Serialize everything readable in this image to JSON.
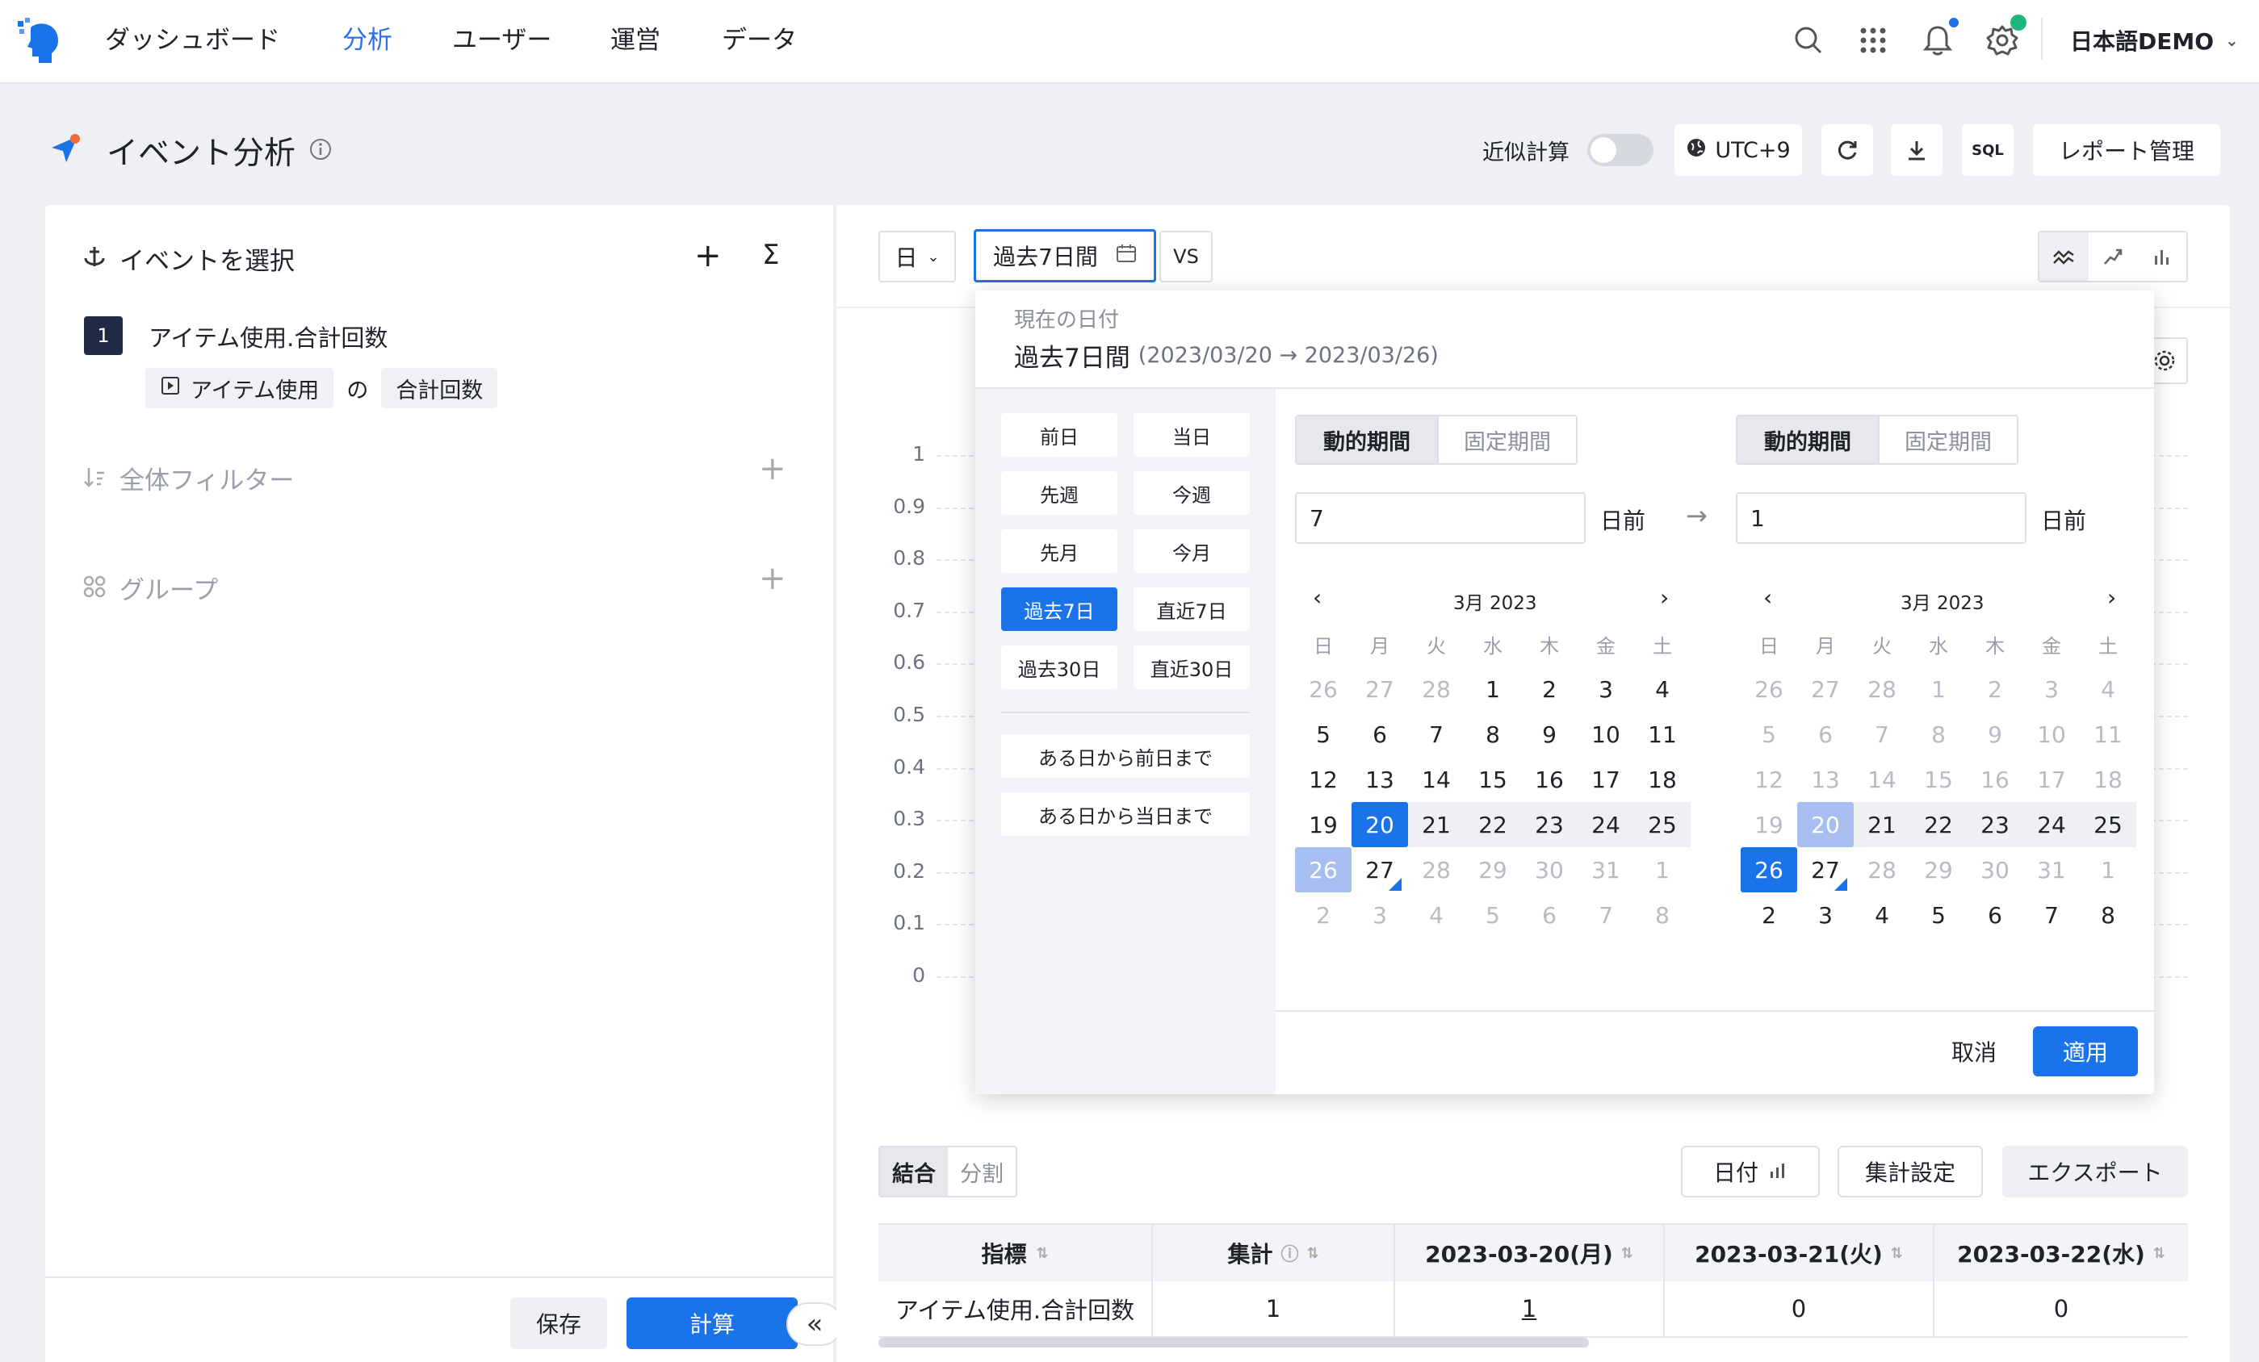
{
  "nav": {
    "items": [
      "ダッシュボード",
      "分析",
      "ユーザー",
      "運営",
      "データ"
    ],
    "active_index": 1,
    "user": "日本語DEMO"
  },
  "header": {
    "title": "イベント分析",
    "approx_label": "近似計算",
    "timezone": "UTC+9",
    "sql": "SQL",
    "report_button": "レポート管理"
  },
  "left": {
    "event_section": "イベントを選択",
    "event_index": "1",
    "event_name": "アイテム使用.合計回数",
    "event_chip": "アイテム使用",
    "of": "の",
    "metric_chip": "合計回数",
    "filter_section": "全体フィルター",
    "group_section": "グループ",
    "save": "保存",
    "calc": "計算",
    "collapse": "«"
  },
  "toolbar": {
    "granularity": "日",
    "range": "過去7日間",
    "vs": "VS"
  },
  "chart": {
    "y_ticks": [
      "1",
      "0.9",
      "0.8",
      "0.7",
      "0.6",
      "0.5",
      "0.4",
      "0.3",
      "0.2",
      "0.1",
      "0"
    ]
  },
  "picker": {
    "current_label": "現在の日付",
    "current_range": "過去7日間",
    "current_dates": "(2023/03/20 → 2023/03/26)",
    "presets": [
      "前日",
      "当日",
      "先週",
      "今週",
      "先月",
      "今月",
      "過去7日",
      "直近7日",
      "過去30日",
      "直近30日"
    ],
    "presets_long": [
      "ある日から前日まで",
      "ある日から当日まで"
    ],
    "mode_dynamic": "動的期間",
    "mode_fixed": "固定期間",
    "start_value": "7",
    "end_value": "1",
    "days_before": "日前",
    "month_title": "3月 2023",
    "weekdays": [
      "日",
      "月",
      "火",
      "水",
      "木",
      "金",
      "土"
    ],
    "weeks": [
      [
        "26",
        "27",
        "28",
        "1",
        "2",
        "3",
        "4"
      ],
      [
        "5",
        "6",
        "7",
        "8",
        "9",
        "10",
        "11"
      ],
      [
        "12",
        "13",
        "14",
        "15",
        "16",
        "17",
        "18"
      ],
      [
        "19",
        "20",
        "21",
        "22",
        "23",
        "24",
        "25"
      ],
      [
        "26",
        "27",
        "28",
        "29",
        "30",
        "31",
        "1"
      ],
      [
        "2",
        "3",
        "4",
        "5",
        "6",
        "7",
        "8"
      ]
    ],
    "cancel": "取消",
    "apply": "適用"
  },
  "table": {
    "tab_combined": "結合",
    "tab_split": "分割",
    "date_btn": "日付",
    "agg_btn": "集計設定",
    "export_btn": "エクスポート",
    "headers": [
      "指標",
      "集計",
      "2023-03-20(月)",
      "2023-03-21(火)",
      "2023-03-22(水)"
    ],
    "row": [
      "アイテム使用.合計回数",
      "1",
      "1",
      "0",
      "0"
    ]
  }
}
